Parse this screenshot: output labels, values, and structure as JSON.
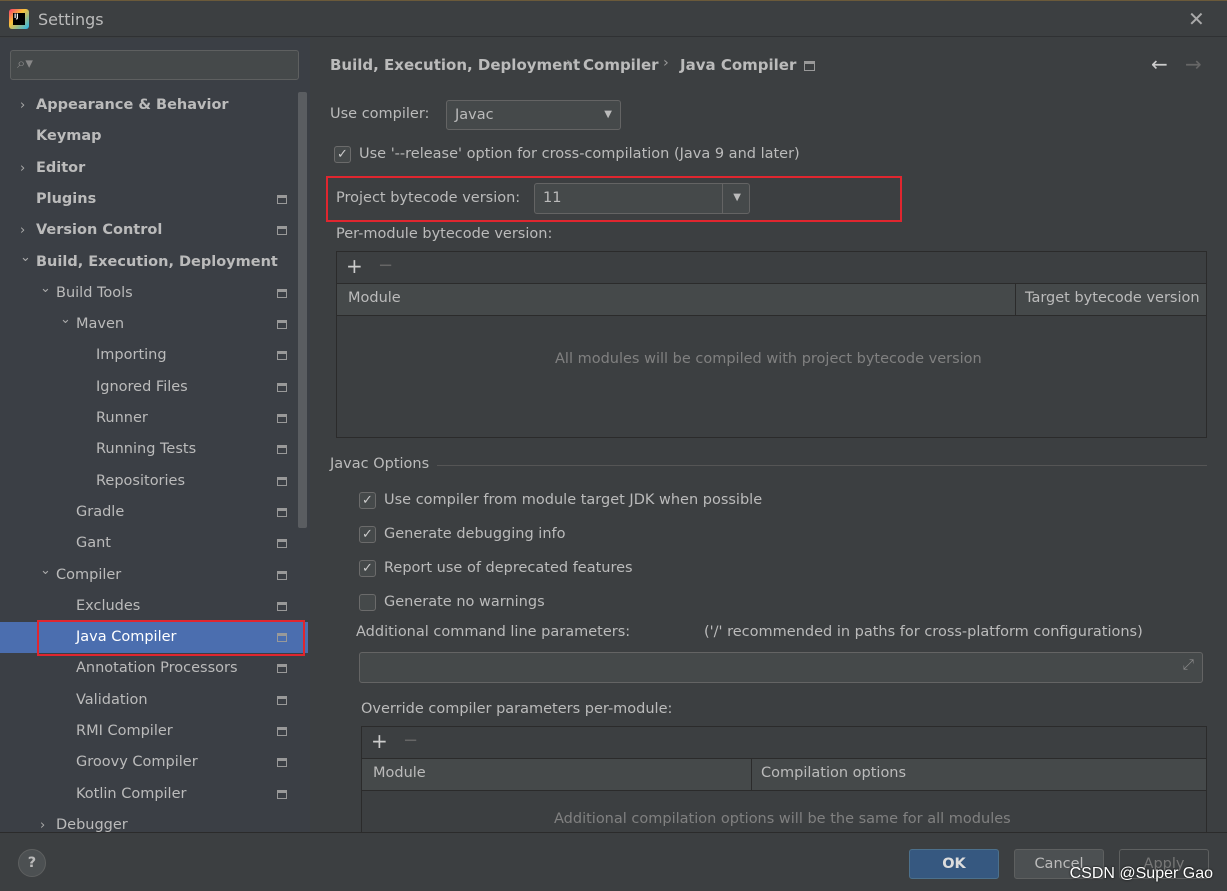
{
  "window": {
    "title": "Settings",
    "close": "✕"
  },
  "colors": {
    "accent": "#4b6eaf",
    "highlight": "#e0262f",
    "background": "#3c3f41"
  },
  "sidebar": {
    "search_placeholder": "",
    "search_icon": "⌕▾",
    "items": [
      {
        "label": "Appearance & Behavior",
        "level": 0,
        "arrow": "›",
        "bold": true,
        "page": false
      },
      {
        "label": "Keymap",
        "level": 0,
        "arrow": "",
        "bold": true,
        "page": false
      },
      {
        "label": "Editor",
        "level": 0,
        "arrow": "›",
        "bold": true,
        "page": false
      },
      {
        "label": "Plugins",
        "level": 0,
        "arrow": "",
        "bold": true,
        "page": true
      },
      {
        "label": "Version Control",
        "level": 0,
        "arrow": "›",
        "bold": true,
        "page": true
      },
      {
        "label": "Build, Execution, Deployment",
        "level": 0,
        "arrow": "⌄",
        "bold": true,
        "page": false
      },
      {
        "label": "Build Tools",
        "level": 1,
        "arrow": "⌄",
        "page": true
      },
      {
        "label": "Maven",
        "level": 2,
        "arrow": "⌄",
        "page": true
      },
      {
        "label": "Importing",
        "level": 3,
        "arrow": "",
        "page": true
      },
      {
        "label": "Ignored Files",
        "level": 3,
        "arrow": "",
        "page": true
      },
      {
        "label": "Runner",
        "level": 3,
        "arrow": "",
        "page": true
      },
      {
        "label": "Running Tests",
        "level": 3,
        "arrow": "",
        "page": true
      },
      {
        "label": "Repositories",
        "level": 3,
        "arrow": "",
        "page": true
      },
      {
        "label": "Gradle",
        "level": 2,
        "arrow": "",
        "page": true
      },
      {
        "label": "Gant",
        "level": 2,
        "arrow": "",
        "page": true
      },
      {
        "label": "Compiler",
        "level": 1,
        "arrow": "⌄",
        "page": true
      },
      {
        "label": "Excludes",
        "level": 2,
        "arrow": "",
        "page": true
      },
      {
        "label": "Java Compiler",
        "level": 2,
        "arrow": "",
        "page": true,
        "selected": true
      },
      {
        "label": "Annotation Processors",
        "level": 2,
        "arrow": "",
        "page": true
      },
      {
        "label": "Validation",
        "level": 2,
        "arrow": "",
        "page": true
      },
      {
        "label": "RMI Compiler",
        "level": 2,
        "arrow": "",
        "page": true
      },
      {
        "label": "Groovy Compiler",
        "level": 2,
        "arrow": "",
        "page": true
      },
      {
        "label": "Kotlin Compiler",
        "level": 2,
        "arrow": "",
        "page": true
      },
      {
        "label": "Debugger",
        "level": 1,
        "arrow": "›",
        "page": false
      }
    ]
  },
  "breadcrumb": {
    "items": [
      "Build, Execution, Deployment",
      "Compiler",
      "Java Compiler"
    ],
    "sep": "›",
    "back": "←",
    "forward": "→"
  },
  "compiler": {
    "label": "Use compiler:",
    "value": "Javac"
  },
  "release_option": {
    "label": "Use '--release' option for cross-compilation (Java 9 and later)",
    "checked": true
  },
  "bytecode": {
    "label": "Project bytecode version:",
    "value": "11"
  },
  "per_module": {
    "label": "Per-module bytecode version:",
    "add": "+",
    "remove": "−",
    "columns": [
      "Module",
      "Target bytecode version"
    ],
    "empty": "All modules will be compiled with project bytecode version"
  },
  "javac": {
    "section": "Javac Options",
    "options": [
      {
        "label": "Use compiler from module target JDK when possible",
        "checked": true
      },
      {
        "label": "Generate debugging info",
        "checked": true
      },
      {
        "label": "Report use of deprecated features",
        "checked": true
      },
      {
        "label": "Generate no warnings",
        "checked": false
      }
    ],
    "params_label": "Additional command line parameters:",
    "params_hint": "('/' recommended in paths for cross-platform configurations)",
    "params_value": "",
    "expand": "⤢"
  },
  "override": {
    "label": "Override compiler parameters per-module:",
    "add": "+",
    "remove": "−",
    "columns": [
      "Module",
      "Compilation options"
    ],
    "empty": "Additional compilation options will be the same for all modules"
  },
  "footer": {
    "help": "?",
    "ok": "OK",
    "cancel": "Cancel",
    "apply": "Apply"
  },
  "watermark": "CSDN @Super Gao"
}
